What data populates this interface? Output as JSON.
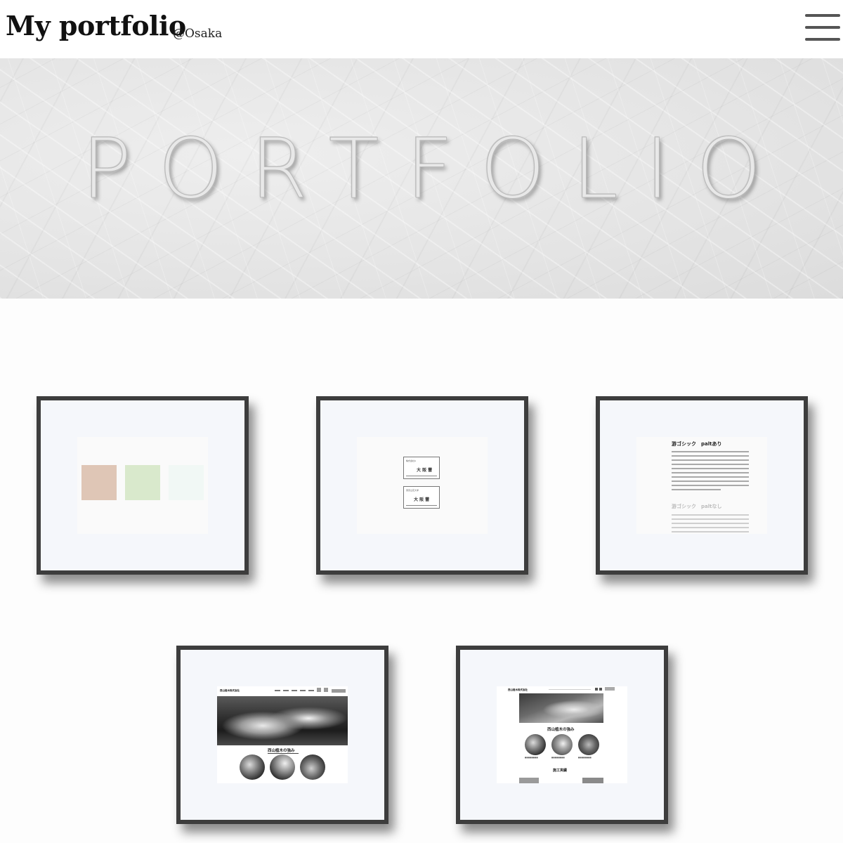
{
  "header": {
    "title": "My portfolio",
    "subtitle": "@Osaka",
    "menu_icon": "hamburger-menu-icon"
  },
  "hero": {
    "heading": "PORTFOLIO"
  },
  "works": [
    {
      "id": 1,
      "type": "color-palette",
      "swatch_colors": [
        "#dfc6b6",
        "#d9e9cc",
        "#f1f8f5"
      ]
    },
    {
      "id": 2,
      "type": "business-cards",
      "card1": {
        "company": "株式会社A",
        "name": "大 阪 蕾"
      },
      "card2": {
        "company": "東京立花大学",
        "name": "大 阪 蕾"
      }
    },
    {
      "id": 3,
      "type": "typography",
      "heading1": "游ゴシック　paltあり",
      "heading2": "游ゴシック　paltなし"
    },
    {
      "id": 4,
      "type": "website",
      "logo": "西山植木株式会社",
      "section_title": "西山植木の強み"
    },
    {
      "id": 5,
      "type": "website",
      "logo": "西山植木株式会社",
      "section_title": "西山植木の強み",
      "section_title2": "施工実績"
    }
  ]
}
